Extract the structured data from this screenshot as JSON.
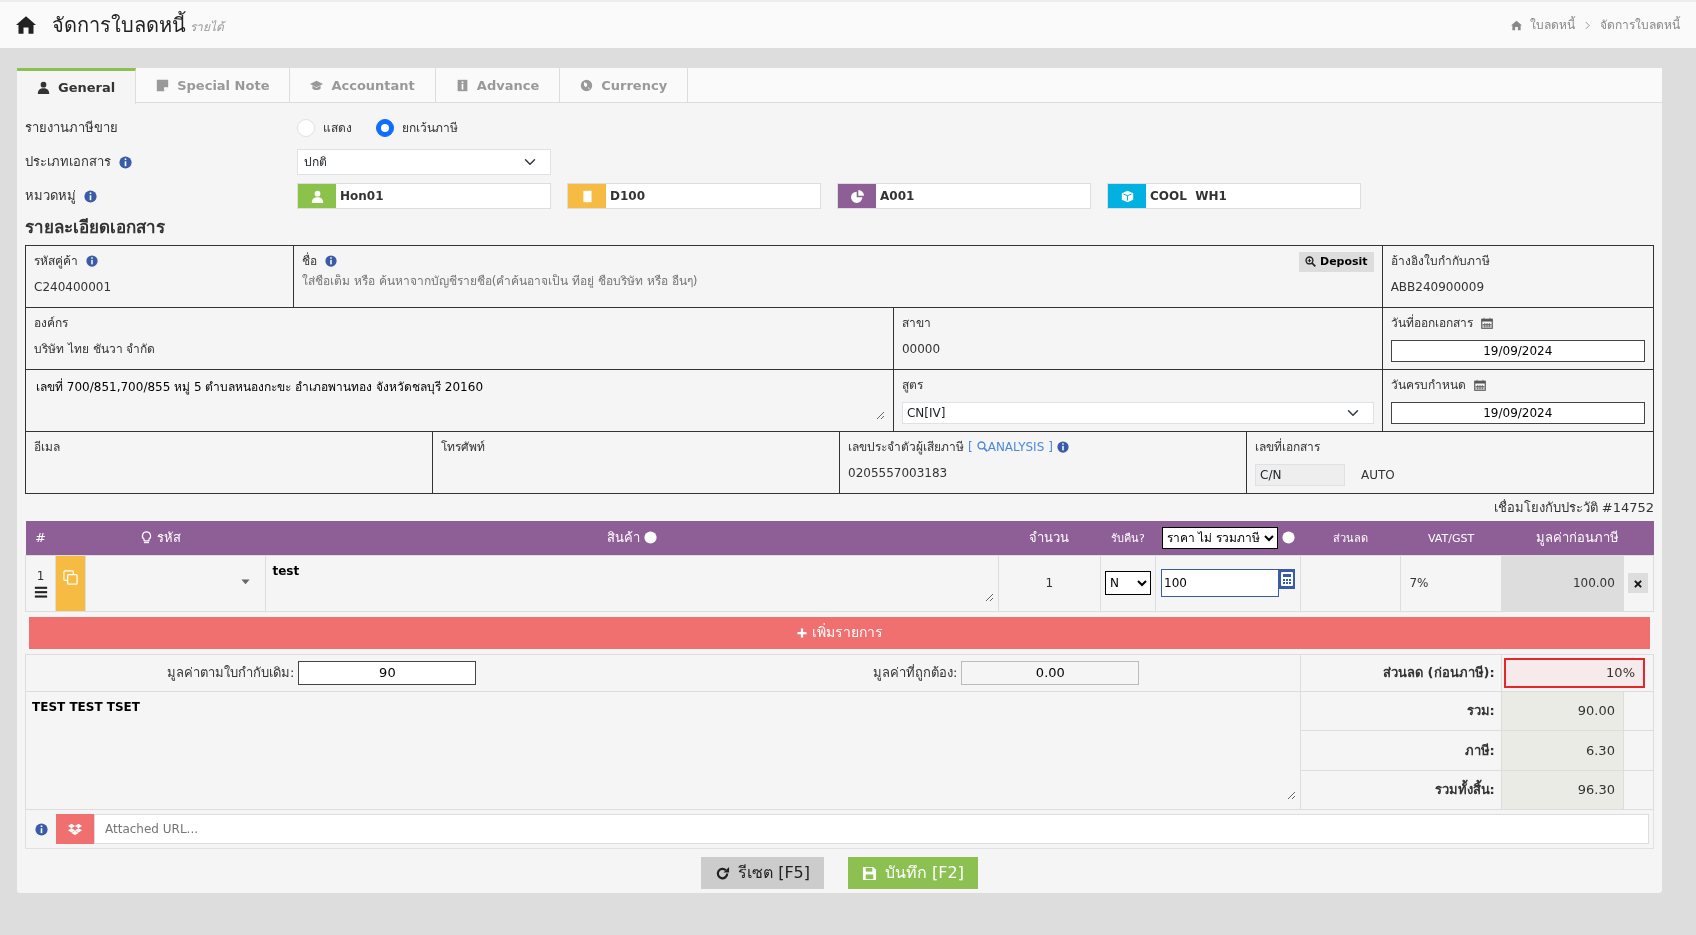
{
  "header": {
    "title": "จัดการใบลดหนี้",
    "subtitle": "รายได้",
    "breadcrumb": [
      "ใบลดหนี้",
      "จัดการใบลดหนี้"
    ]
  },
  "tabs": [
    {
      "label": "General",
      "selected": true
    },
    {
      "label": "Special Note",
      "selected": false
    },
    {
      "label": "Accountant",
      "selected": false
    },
    {
      "label": "Advance",
      "selected": false
    },
    {
      "label": "Currency",
      "selected": false
    }
  ],
  "tax_report": {
    "label": "รายงานภาษีขาย",
    "options": [
      {
        "label": "แสดง",
        "selected": false
      },
      {
        "label": "ยกเว้นภาษี",
        "selected": true
      }
    ]
  },
  "doc_type": {
    "label": "ประเภทเอกสาร",
    "value": "ปกติ"
  },
  "categories": {
    "label": "หมวดหมู่",
    "items": [
      {
        "value": "Hon01",
        "color": "#8bc34a"
      },
      {
        "value": "D100",
        "color": "#f6bb42"
      },
      {
        "value": "A001",
        "color": "#8e5e96"
      },
      {
        "value": "COOL  WH1",
        "color": "#00b1e1"
      }
    ]
  },
  "details": {
    "heading": "รายละเอียดเอกสาร",
    "customer_code": {
      "label": "รหัสคู่ค้า",
      "value": "C240400001"
    },
    "name": {
      "label": "ชื่อ",
      "placeholder": "ใส่ชื่อเต็ม หรือ ค้นหาจากบัญชีรายชื่อ(คำค้นอาจเป็น ที่อยู่ ชื่อบริษัท หรือ อื่นๆ)"
    },
    "deposit_button": "Deposit",
    "tax_invoice_ref": {
      "label": "อ้างอิงใบกำกับภาษี",
      "value": "ABB240900009"
    },
    "organization": {
      "label": "องค์กร",
      "value": "บริษัท ไทย ชันวา จำกัด"
    },
    "branch": {
      "label": "สาขา",
      "value": "00000"
    },
    "issue_date": {
      "label": "วันที่ออกเอกสาร",
      "value": "19/09/2024"
    },
    "address": {
      "value": "เลขที่ 700/851,700/855 หมู่ 5 ตำบลหนองกะขะ อำเภอพานทอง จังหวัดชลบุรี 20160"
    },
    "formula": {
      "label": "สูตร",
      "value": "CN[IV]"
    },
    "due_date": {
      "label": "วันครบกำหนด",
      "value": "19/09/2024"
    },
    "email": {
      "label": "อีเมล"
    },
    "phone": {
      "label": "โทรศัพท์"
    },
    "tax_id": {
      "label": "เลขประจำตัวผู้เสียภาษี",
      "link": "ANALYSIS",
      "link_brackets": [
        "[",
        "]"
      ],
      "value": "0205557003183"
    },
    "doc_no": {
      "label": "เลขที่เอกสาร",
      "value": "C/N",
      "note": "AUTO"
    }
  },
  "history_link": "เชื่อมโยงกับประวัติ #14752",
  "items": {
    "columns": [
      "#",
      "รหัส",
      "สินค้า",
      "จำนวน",
      "รับคืน?",
      "ราคา ไม่ รวมภาษี",
      "ส่วนลด",
      "VAT/GST",
      "มูลค่าก่อนภาษี"
    ],
    "rows": [
      {
        "no": "1",
        "description": "test",
        "qty": "1",
        "return": "N",
        "price": "100",
        "vat": "7%",
        "amount": "100.00"
      }
    ],
    "add_button": "เพิ่มรายการ"
  },
  "totals": {
    "original_value": {
      "label": "มูลค่าตามใบกำกับเดิม:",
      "value": "90"
    },
    "correct_value": {
      "label": "มูลค่าที่ถูกต้อง:",
      "value": "0.00"
    },
    "discount": {
      "label": "ส่วนลด (ก่อนภาษี):",
      "value": "10%",
      "invalid": true
    },
    "summary": [
      {
        "label": "รวม:",
        "value": "90.00"
      },
      {
        "label": "ภาษี:",
        "value": "6.30"
      },
      {
        "label": "รวมทั้งสิ้น:",
        "value": "96.30"
      }
    ]
  },
  "note": "TEST TEST TSET",
  "attached": {
    "placeholder": "Attached URL..."
  },
  "buttons": [
    {
      "label": "รีเซต [F5]",
      "kind": "reset"
    },
    {
      "label": "บันทึก [F2]",
      "kind": "save"
    }
  ]
}
